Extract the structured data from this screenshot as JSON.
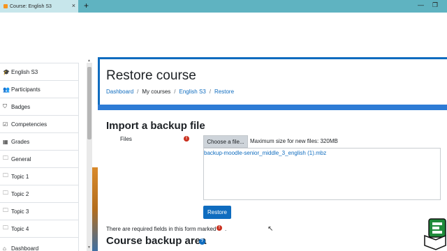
{
  "browser": {
    "tab_title": "Course: English S3",
    "tab_close": "×",
    "new_tab": "+",
    "minimize": "—",
    "maximize": "❐"
  },
  "sidebar": {
    "items": [
      {
        "label": "English S3",
        "icon": "graduation-cap-icon",
        "glyph": "🎓"
      },
      {
        "label": "Participants",
        "icon": "users-icon",
        "glyph": "👥"
      },
      {
        "label": "Badges",
        "icon": "shield-icon",
        "glyph": "⛉"
      },
      {
        "label": "Competencies",
        "icon": "checkbox-icon",
        "glyph": "☑"
      },
      {
        "label": "Grades",
        "icon": "table-icon",
        "glyph": "▦"
      },
      {
        "label": "General",
        "icon": "folder-icon",
        "glyph": "🗀"
      },
      {
        "label": "Topic 1",
        "icon": "folder-icon",
        "glyph": "🗀"
      },
      {
        "label": "Topic 2",
        "icon": "folder-icon",
        "glyph": "🗀"
      },
      {
        "label": "Topic 3",
        "icon": "folder-icon",
        "glyph": "🗀"
      },
      {
        "label": "Topic 4",
        "icon": "folder-icon",
        "glyph": "🗀"
      },
      {
        "label": "Dashboard",
        "icon": "dashboard-icon",
        "glyph": "⌂"
      }
    ]
  },
  "header": {
    "title": "Restore course",
    "breadcrumb": {
      "dashboard": "Dashboard",
      "my_courses": "My courses",
      "course": "English S3",
      "current": "Restore",
      "separator": "/"
    }
  },
  "form": {
    "section_title": "Import a backup file",
    "files_label": "Files",
    "required_glyph": "!",
    "choose_button": "Choose a file...",
    "max_size": "Maximum size for new files: 320MB",
    "selected_file": "backup-moodle-senior_middle_3_english (1).mbz",
    "restore_button": "Restore",
    "required_note": "There are required fields in this form marked",
    "required_note_end": ".",
    "section2_title": "Course backup area",
    "help_glyph": "?"
  },
  "colors": {
    "accent": "#0f6cbf",
    "tabbar": "#5fb3c1",
    "required": "#ca3120"
  }
}
